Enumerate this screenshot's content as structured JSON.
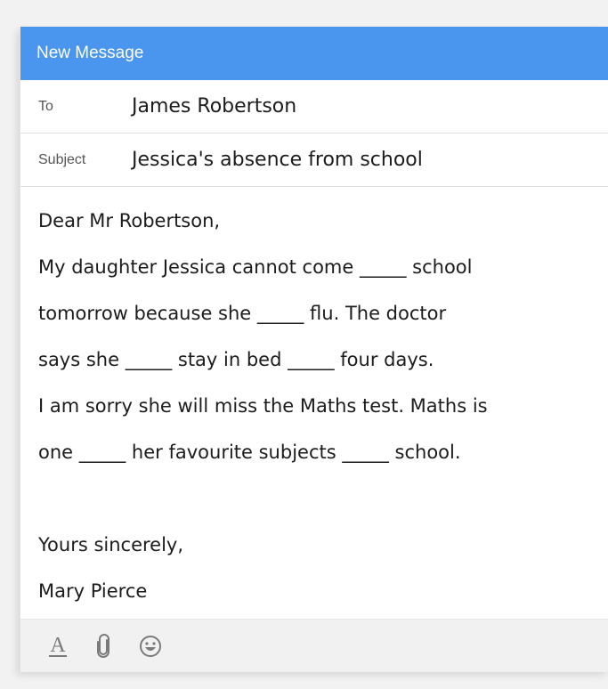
{
  "window": {
    "title": "New Message"
  },
  "to": {
    "label": "To",
    "value": "James Robertson"
  },
  "subject": {
    "label": "Subject",
    "value": "Jessica's absence from school"
  },
  "body": {
    "lines": [
      "Dear Mr Robertson,",
      "My daughter Jessica cannot come _____ school",
      "tomorrow  because she _____ flu. The doctor",
      "says she _____ stay in bed _____ four days.",
      "I am sorry she will miss the Maths test. Maths is",
      "one _____ her favourite subjects _____ school.",
      "",
      "Yours sincerely,",
      "Mary Pierce"
    ]
  },
  "toolbar": {
    "icons": [
      "text-format-icon",
      "attachment-icon",
      "emoji-icon"
    ],
    "font_glyph": "A"
  },
  "colors": {
    "title_bar": "#4a95ee",
    "toolbar_bg": "#f1f1f1",
    "icon": "#7a7a7a"
  }
}
